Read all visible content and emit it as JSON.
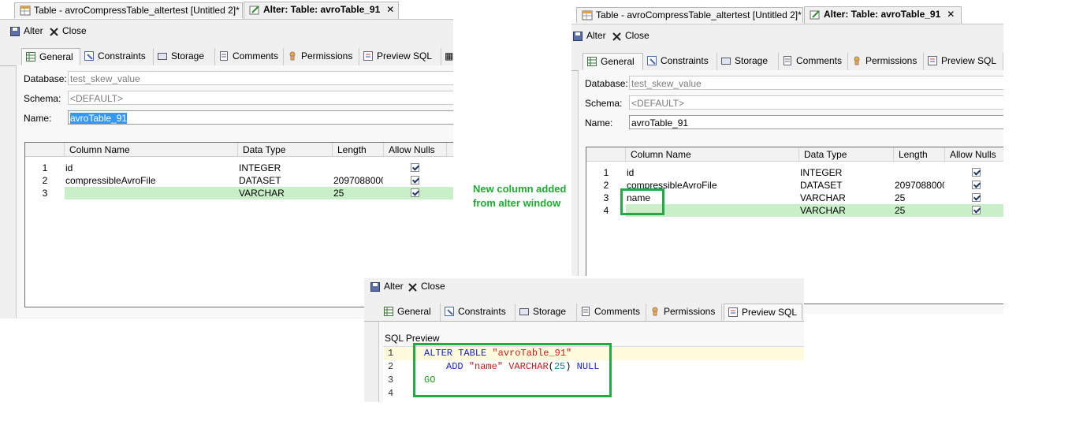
{
  "left": {
    "editor_tabs": [
      {
        "label": "Table - avroCompressTable_altertest [Untitled 2]*",
        "close": "✕"
      },
      {
        "label": "Alter: Table: avroTable_91",
        "close": "✕"
      }
    ],
    "toolbar": {
      "alter": "Alter",
      "close": "Close"
    },
    "tabs": [
      "General",
      "Constraints",
      "Storage",
      "Comments",
      "Permissions",
      "Preview SQL"
    ],
    "fields": {
      "database_label": "Database:",
      "database_value": "test_skew_value",
      "schema_label": "Schema:",
      "schema_value": "<DEFAULT>",
      "name_label": "Name:",
      "name_value": "avroTable_91"
    },
    "grid": {
      "headers": [
        "Column Name",
        "Data Type",
        "Length",
        "Allow Nulls"
      ],
      "rows": [
        {
          "num": "1",
          "name": "id",
          "type": "INTEGER",
          "length": ""
        },
        {
          "num": "2",
          "name": "compressibleAvroFile",
          "type": "DATASET",
          "length": "2097088000"
        },
        {
          "num": "3",
          "name": "",
          "type": "VARCHAR",
          "length": "25"
        }
      ]
    }
  },
  "right": {
    "editor_tabs": [
      {
        "label": "Table - avroCompressTable_altertest [Untitled 2]*",
        "close": "✕"
      },
      {
        "label": "Alter: Table: avroTable_91",
        "close": "✕"
      }
    ],
    "toolbar": {
      "alter": "Alter",
      "close": "Close"
    },
    "tabs": [
      "General",
      "Constraints",
      "Storage",
      "Comments",
      "Permissions",
      "Preview SQL"
    ],
    "fields": {
      "database_label": "Database:",
      "database_value": "test_skew_value",
      "schema_label": "Schema:",
      "schema_value": "<DEFAULT>",
      "name_label": "Name:",
      "name_value": "avroTable_91"
    },
    "grid": {
      "headers": [
        "Column Name",
        "Data Type",
        "Length",
        "Allow Nulls"
      ],
      "rows": [
        {
          "num": "1",
          "name": "id",
          "type": "INTEGER",
          "length": ""
        },
        {
          "num": "2",
          "name": "compressibleAvroFile",
          "type": "DATASET",
          "length": "2097088000"
        },
        {
          "num": "3",
          "name": "name",
          "type": "VARCHAR",
          "length": "25"
        },
        {
          "num": "4",
          "name": "",
          "type": "VARCHAR",
          "length": "25"
        }
      ]
    }
  },
  "annotation": {
    "line1": "New column added",
    "line2": "from alter window",
    "color": "#1faa33"
  },
  "bottom": {
    "toolbar": {
      "alter": "Alter",
      "close": "Close"
    },
    "tabs": [
      "General",
      "Constraints",
      "Storage",
      "Comments",
      "Permissions",
      "Preview SQL"
    ],
    "sql_preview_label": "SQL Preview",
    "line_numbers": [
      "1",
      "2",
      "3",
      "4"
    ],
    "sql": {
      "l1_kw": "ALTER TABLE ",
      "l1_str": "\"avroTable_91\"",
      "l2_kw": "ADD ",
      "l2_str": "\"name\"",
      "l2_type": " VARCHAR",
      "l2_open": "(",
      "l2_num": "25",
      "l2_close": ")",
      "l2_null": " NULL",
      "l3_go": "GO"
    }
  }
}
